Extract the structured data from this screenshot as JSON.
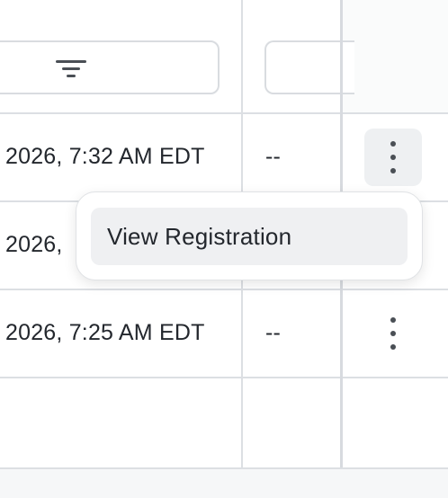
{
  "table": {
    "rows": [
      {
        "date": "2026, 7:32 AM EDT",
        "value": "--"
      },
      {
        "date": "2026, ",
        "value": ""
      },
      {
        "date": "2026, 7:25 AM EDT",
        "value": "--"
      }
    ]
  },
  "menu": {
    "items": [
      {
        "label": "View Registration"
      }
    ]
  },
  "icons": {
    "filter": "filter-icon",
    "row_actions": "more-vertical-icon"
  }
}
